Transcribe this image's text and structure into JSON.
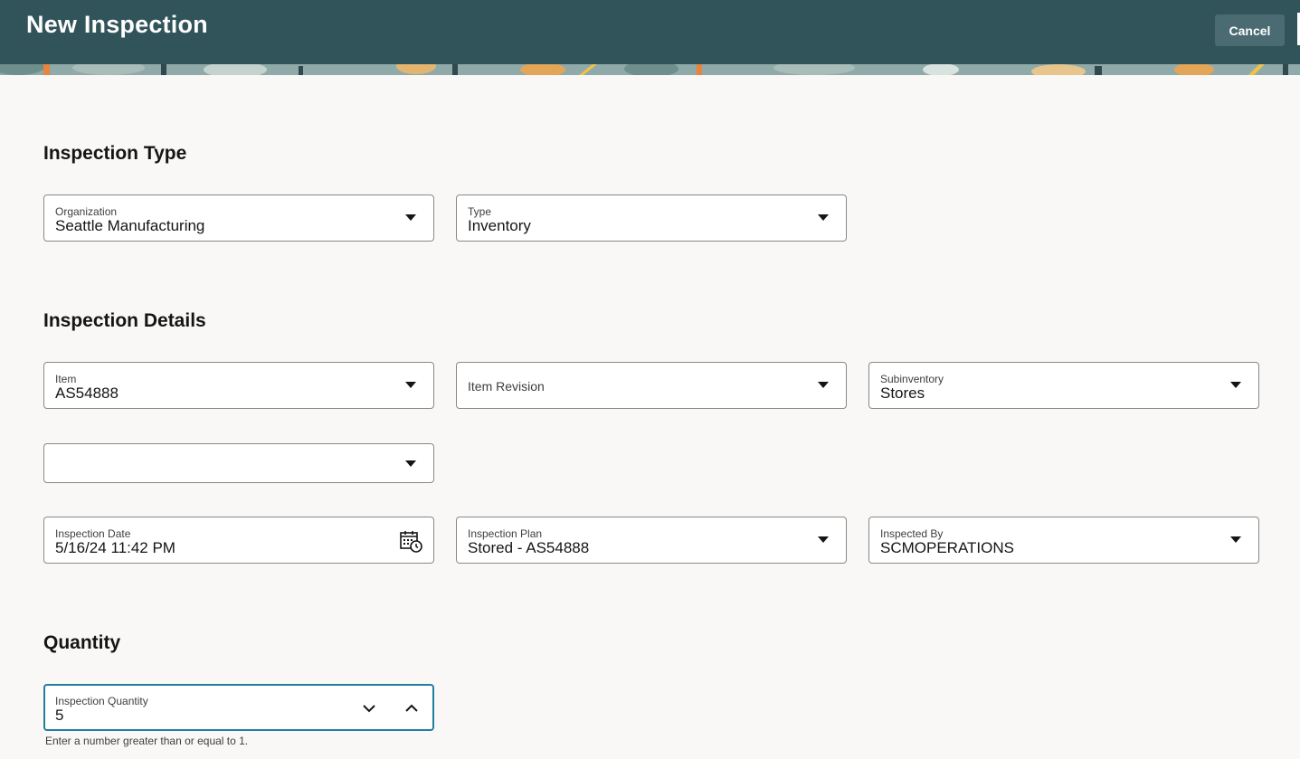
{
  "header": {
    "title": "New Inspection",
    "cancel_label": "Cancel",
    "colors": {
      "bar": "#31535a",
      "button": "#4a6b71"
    }
  },
  "inspection_type": {
    "title": "Inspection Type",
    "organization": {
      "label": "Organization",
      "value": "Seattle Manufacturing",
      "icon": "chevron-down-icon"
    },
    "type": {
      "label": "Type",
      "value": "Inventory",
      "icon": "chevron-down-icon"
    }
  },
  "inspection_details": {
    "title": "Inspection Details",
    "item": {
      "label": "Item",
      "value": "AS54888"
    },
    "item_revision": {
      "placeholder": "Item Revision"
    },
    "subinventory": {
      "label": "Subinventory",
      "value": "Stores"
    },
    "unlabeled_select": {
      "value": ""
    },
    "inspection_date": {
      "label": "Inspection Date",
      "value": "5/16/24 11:42 PM",
      "icon": "calendar-clock-icon"
    },
    "inspection_plan": {
      "label": "Inspection Plan",
      "value": "Stored - AS54888"
    },
    "inspected_by": {
      "label": "Inspected By",
      "value": "SCMOPERATIONS"
    }
  },
  "quantity": {
    "title": "Quantity",
    "inspection_quantity": {
      "label": "Inspection Quantity",
      "value": "5",
      "help": "Enter a number greater than or equal to 1.",
      "focus_color": "#227e9e"
    }
  }
}
